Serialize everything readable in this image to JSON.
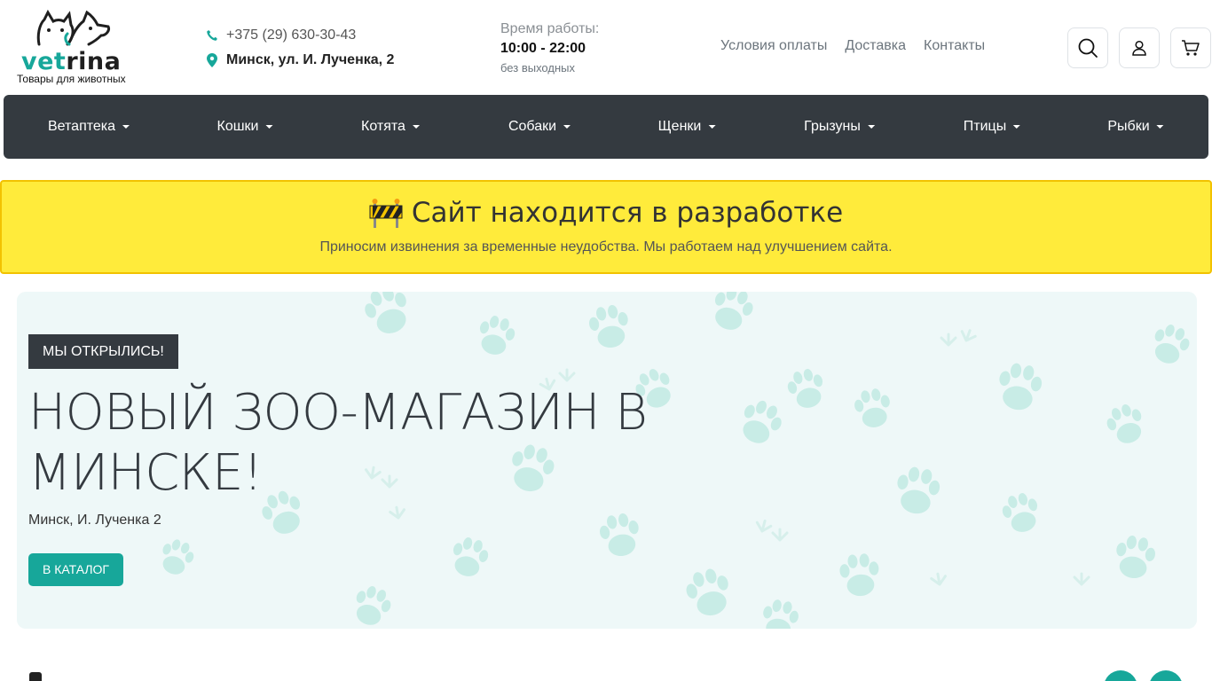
{
  "logo": {
    "brand_accent": "vet",
    "brand_rest": "rina",
    "tagline": "Товары для животных"
  },
  "contact": {
    "phone": "+375 (29) 630-30-43",
    "address": "Минск, ул. И. Лученка, 2"
  },
  "hours": {
    "label": "Время работы:",
    "time": "10:00 - 22:00",
    "note": "без выходных"
  },
  "top_links": [
    "Условия оплаты",
    "Доставка",
    "Контакты"
  ],
  "nav": [
    "Ветаптека",
    "Кошки",
    "Котята",
    "Собаки",
    "Щенки",
    "Грызуны",
    "Птицы",
    "Рыбки"
  ],
  "dev_banner": {
    "title": "Сайт находится в разработке",
    "subtitle": "Приносим извинения за временные неудобства. Мы работаем над улучшением сайта."
  },
  "hero": {
    "badge": "МЫ ОТКРЫЛИСЬ!",
    "title": "НОВЫЙ ЗОО-МАГАЗИН В МИНСКЕ!",
    "subtitle": "Минск, И. Лученка 2",
    "button": "В КАТАЛОГ"
  },
  "icons": {
    "search": "search-icon",
    "user": "user-icon",
    "cart": "cart-icon",
    "phone": "phone-icon",
    "location": "map-pin-icon",
    "construction": "construction-icon"
  },
  "colors": {
    "accent": "#17a79a",
    "navbar": "#343a40",
    "banner": "#ffeb3b",
    "hero_bg": "#eef8f8"
  }
}
